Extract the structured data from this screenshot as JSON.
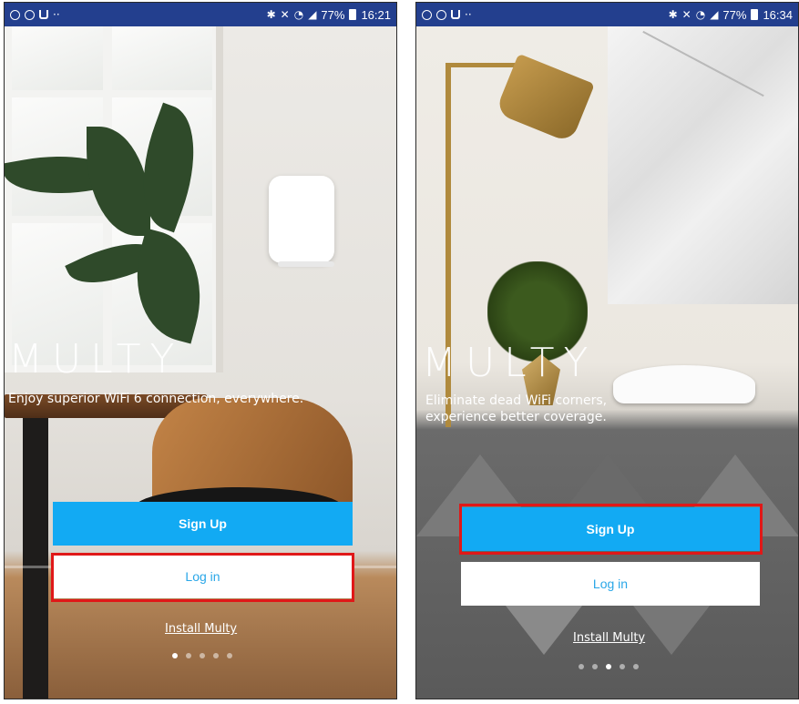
{
  "screens": [
    {
      "status": {
        "battery": "77%",
        "time": "16:21",
        "left_icons": [
          "notification-icon",
          "location-icon",
          "cup-icon",
          "more-icon"
        ]
      },
      "brand": "MULTY",
      "tagline": "Enjoy superior WiFi 6 connection, everywhere.",
      "signup_label": "Sign Up",
      "login_label": "Log in",
      "install_label": "Install Multy",
      "highlighted": "login",
      "pager": {
        "count": 5,
        "active": 0
      }
    },
    {
      "status": {
        "battery": "77%",
        "time": "16:34",
        "left_icons": [
          "notification-icon",
          "location-icon",
          "cup-icon",
          "more-icon"
        ]
      },
      "brand": "MULTY",
      "tagline": "Eliminate dead WiFi corners,\nexperience better coverage.",
      "signup_label": "Sign Up",
      "login_label": "Log in",
      "install_label": "Install Multy",
      "highlighted": "signup",
      "pager": {
        "count": 5,
        "active": 2
      }
    }
  ],
  "colors": {
    "status_bar": "#233f8e",
    "primary_button": "#12aaf3",
    "secondary_text": "#2aa7e8",
    "highlight": "#e01818"
  }
}
